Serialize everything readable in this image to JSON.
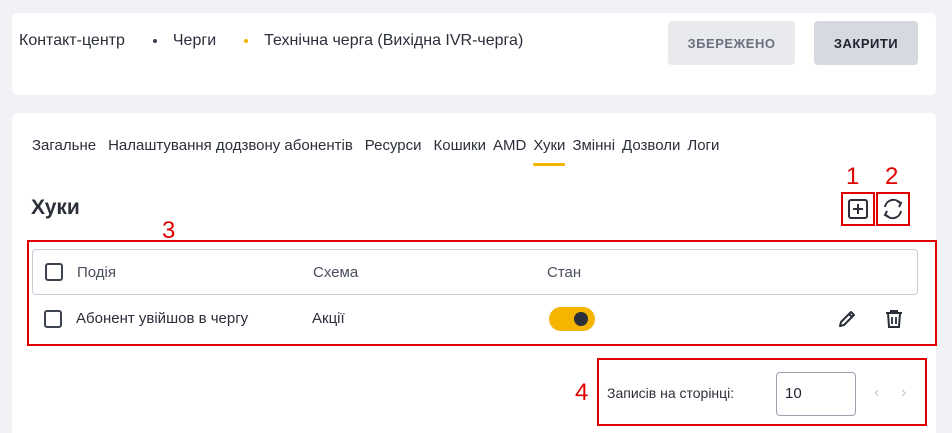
{
  "header": {
    "breadcrumb": [
      "Контакт-центр",
      "Черги",
      "Технічна черга (Вихідна IVR-черга)"
    ],
    "saved_label": "ЗБЕРЕЖЕНО",
    "close_label": "ЗАКРИТИ",
    "accent_color": "#f4b400"
  },
  "tabs": [
    {
      "label": "Загальне"
    },
    {
      "label": "Налаштування додзвону абонентів"
    },
    {
      "label": "Ресурси"
    },
    {
      "label": "Кошики"
    },
    {
      "label": "AMD"
    },
    {
      "label": "Хуки",
      "active": true
    },
    {
      "label": "Змінні"
    },
    {
      "label": "Дозволи"
    },
    {
      "label": "Логи"
    }
  ],
  "section": {
    "title": "Хуки",
    "add_icon": "add-square-icon",
    "refresh_icon": "refresh-icon"
  },
  "annotations": [
    "1",
    "2",
    "3",
    "4"
  ],
  "table": {
    "columns": [
      "Подія",
      "Схема",
      "Стан"
    ],
    "rows": [
      {
        "event": "Абонент увійшов в чергу",
        "schema": "Акції",
        "enabled": true,
        "edit_icon": "pencil-icon",
        "delete_icon": "trash-icon"
      }
    ]
  },
  "pagination": {
    "label": "Записів на сторінці:",
    "per_page": "10"
  }
}
